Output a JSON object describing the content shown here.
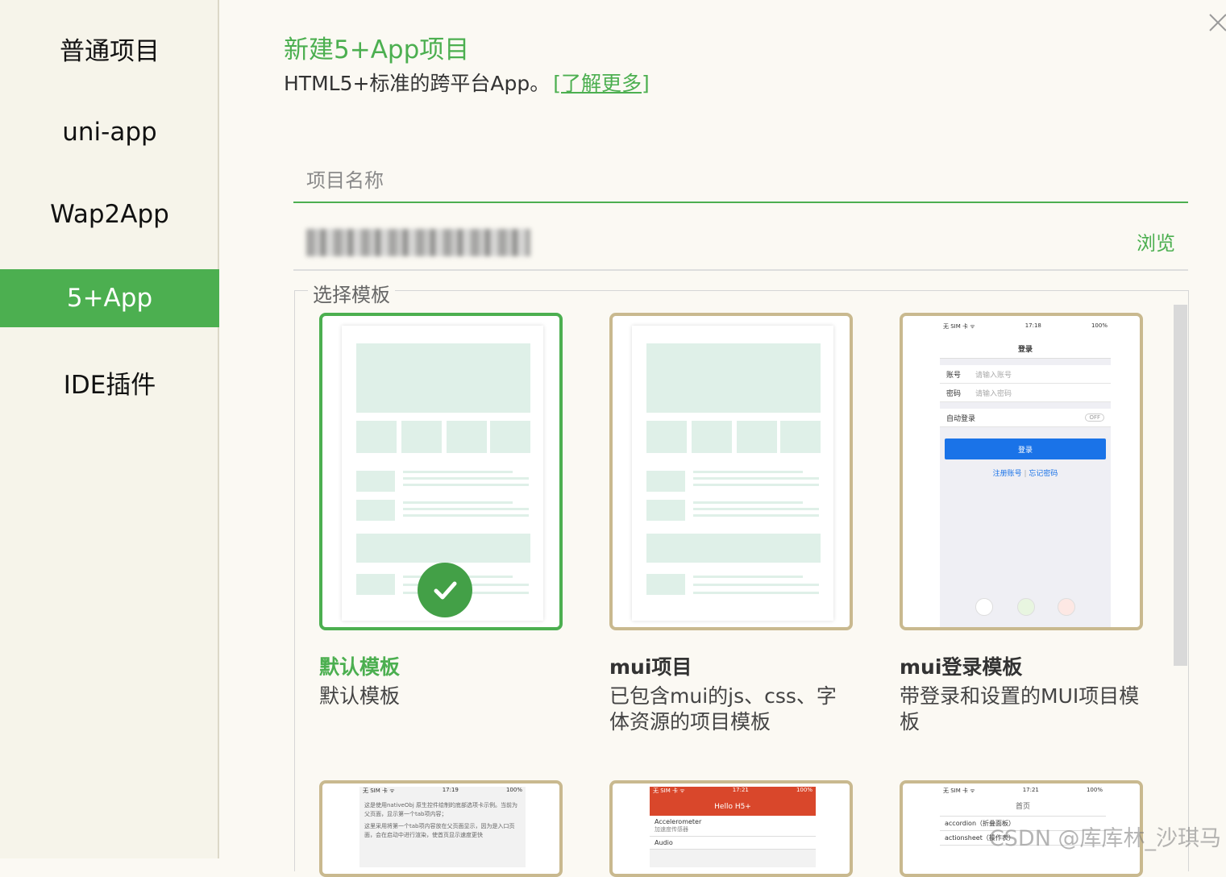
{
  "sidebar": {
    "items": [
      {
        "label": "普通项目"
      },
      {
        "label": "uni-app"
      },
      {
        "label": "Wap2App"
      },
      {
        "label": "5+App"
      },
      {
        "label": "IDE插件"
      }
    ],
    "active_index": 3
  },
  "header": {
    "title": "新建5+App项目",
    "subtitle": "HTML5+标准的跨平台App。",
    "learn_more": "[了解更多]"
  },
  "form": {
    "name_placeholder": "项目名称",
    "name_value": "",
    "browse_label": "浏览"
  },
  "templates": {
    "legend": "选择模板",
    "items": [
      {
        "title": "默认模板",
        "desc": "默认模板",
        "selected": true
      },
      {
        "title": "mui项目",
        "desc": "已包含mui的js、css、字体资源的项目模板",
        "selected": false
      },
      {
        "title": "mui登录模板",
        "desc": "带登录和设置的MUI项目模板",
        "selected": false
      }
    ],
    "login_preview": {
      "status_left": "无 SIM 卡 ᯤ",
      "time": "17:18",
      "battery": "100%",
      "nav_title": "登录",
      "account_label": "账号",
      "account_placeholder": "请输入账号",
      "password_label": "密码",
      "password_placeholder": "请输入密码",
      "auto_login": "自动登录",
      "toggle": "OFF",
      "login_button": "登录",
      "register": "注册账号",
      "forgot": "忘记密码"
    },
    "bottom_previews": [
      {
        "status_left": "无 SIM 卡 ᯤ",
        "time": "17:19",
        "battery": "100%",
        "text1": "这是使用nativeObj 原生控件绘制的底部选项卡示例。当前为父页面，显示第一个tab项内容；",
        "text2": "这里采用将第一个tab项内容放在父页面显示，因为是入口页面，会在启动中进行渲染，使首页显示速度更快"
      },
      {
        "status_left": "无 SIM 卡 ᯤ",
        "time": "17:21",
        "battery": "100%",
        "header": "Hello H5+",
        "item1": "Accelerometer",
        "item1_sub": "加速度传感器",
        "item2": "Audio"
      },
      {
        "status_left": "无 SIM 卡 ᯤ",
        "time": "17:21",
        "battery": "100%",
        "nav_title": "首页",
        "item1": "accordion（折叠面板）",
        "item2": "actionsheet（操作表）"
      }
    ]
  },
  "watermark": "CSDN @库库林_沙琪马",
  "colors": {
    "accent": "#4caf50",
    "card_border": "#c9b98f"
  }
}
